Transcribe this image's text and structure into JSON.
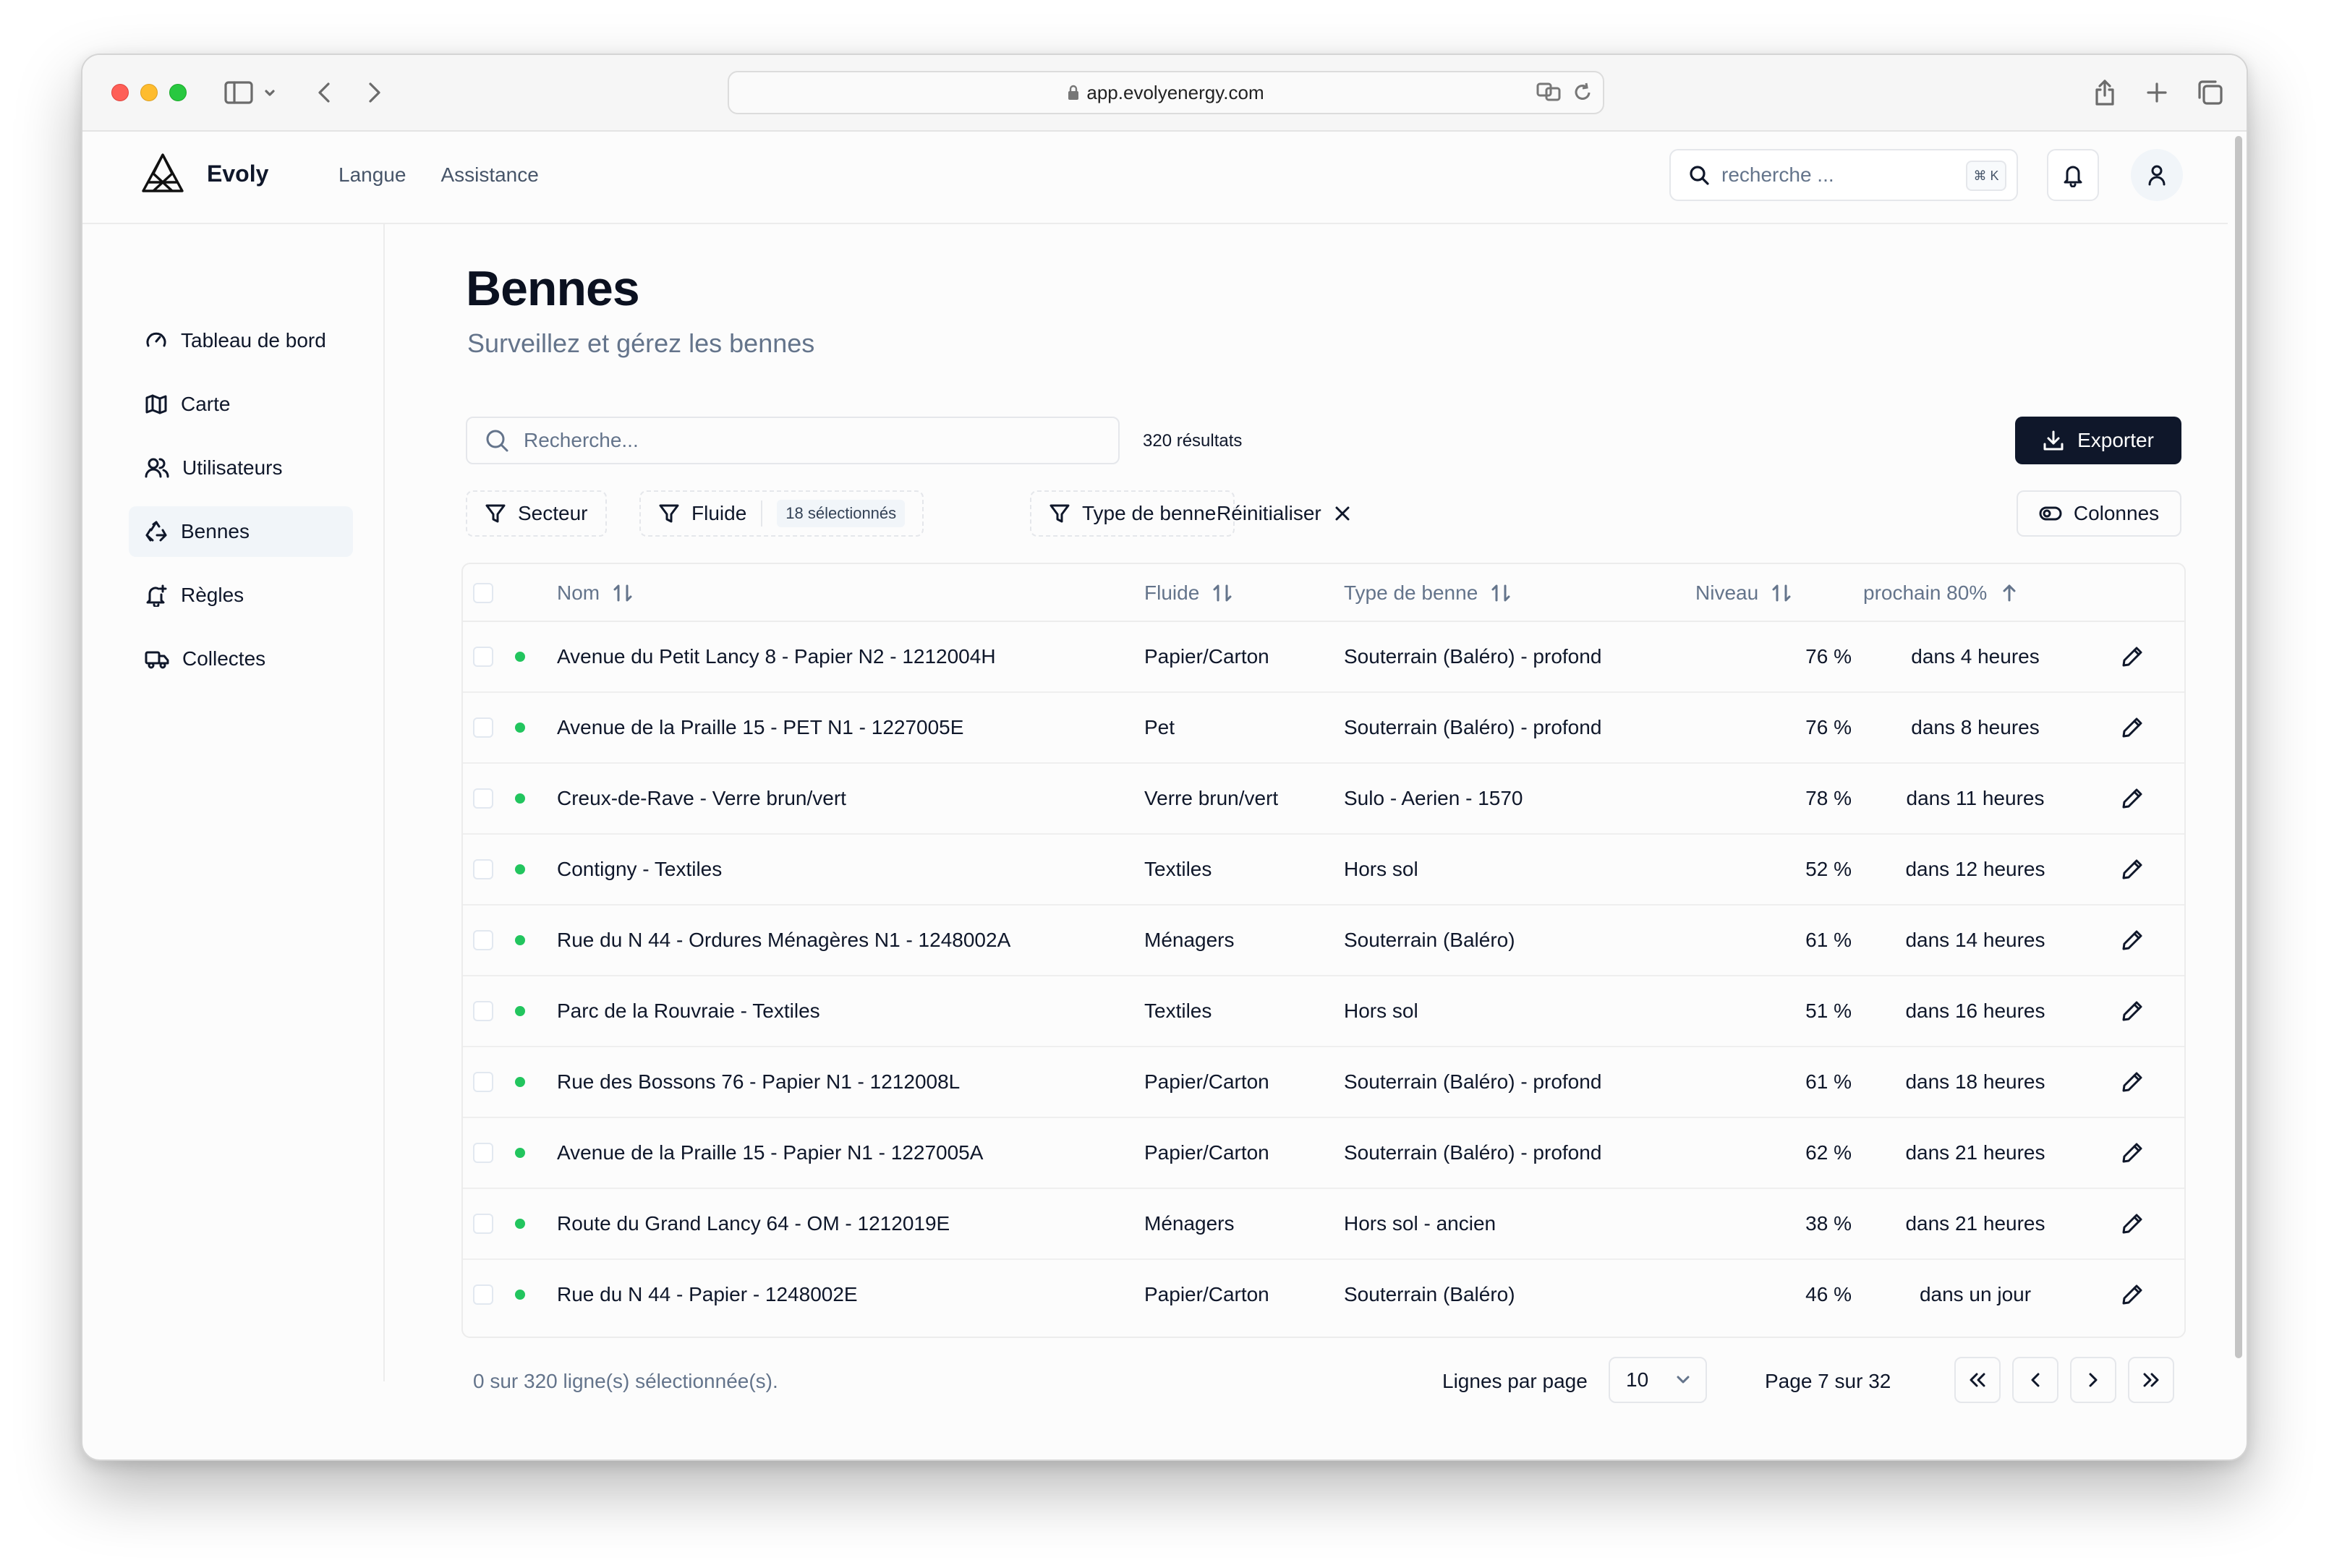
{
  "browser": {
    "url": "app.evolyenergy.com"
  },
  "header": {
    "brand": "Evoly",
    "nav": [
      "Langue",
      "Assistance"
    ],
    "search_placeholder": "recherche ...",
    "search_shortcut": "⌘ K"
  },
  "sidebar": {
    "items": [
      {
        "label": "Tableau de bord",
        "icon": "gauge-icon"
      },
      {
        "label": "Carte",
        "icon": "map-icon"
      },
      {
        "label": "Utilisateurs",
        "icon": "users-icon"
      },
      {
        "label": "Bennes",
        "icon": "recycle-icon",
        "active": true
      },
      {
        "label": "Règles",
        "icon": "bell-plus-icon"
      },
      {
        "label": "Collectes",
        "icon": "truck-icon"
      }
    ]
  },
  "page": {
    "title": "Bennes",
    "subtitle": "Surveillez et gérez les bennes"
  },
  "toolbar": {
    "search_placeholder": "Recherche...",
    "result_count": "320 résultats",
    "export_label": "Exporter",
    "filters": {
      "secteur": "Secteur",
      "fluide": "Fluide",
      "fluide_badge": "18 sélectionnés",
      "type": "Type de benne"
    },
    "reset_label": "Réinitialiser",
    "columns_label": "Colonnes"
  },
  "table": {
    "headers": {
      "nom": "Nom",
      "fluide": "Fluide",
      "type": "Type de benne",
      "niveau": "Niveau",
      "prochain": "prochain 80%"
    },
    "rows": [
      {
        "nom": "Avenue du Petit Lancy 8 - Papier N2 - 1212004H",
        "fluide": "Papier/Carton",
        "type": "Souterrain (Baléro) - profond",
        "niveau": "76 %",
        "prochain": "dans 4 heures"
      },
      {
        "nom": "Avenue de la Praille 15 - PET N1 - 1227005E",
        "fluide": "Pet",
        "type": "Souterrain (Baléro) - profond",
        "niveau": "76 %",
        "prochain": "dans 8 heures"
      },
      {
        "nom": "Creux-de-Rave - Verre brun/vert",
        "fluide": "Verre brun/vert",
        "type": "Sulo - Aerien - 1570",
        "niveau": "78 %",
        "prochain": "dans 11 heures"
      },
      {
        "nom": "Contigny - Textiles",
        "fluide": "Textiles",
        "type": "Hors sol",
        "niveau": "52 %",
        "prochain": "dans 12 heures"
      },
      {
        "nom": "Rue du N 44 - Ordures Ménagères N1 - 1248002A",
        "fluide": "Ménagers",
        "type": "Souterrain (Baléro)",
        "niveau": "61 %",
        "prochain": "dans 14 heures"
      },
      {
        "nom": "Parc de la Rouvraie - Textiles",
        "fluide": "Textiles",
        "type": "Hors sol",
        "niveau": "51 %",
        "prochain": "dans 16 heures"
      },
      {
        "nom": "Rue des Bossons 76 - Papier N1 - 1212008L",
        "fluide": "Papier/Carton",
        "type": "Souterrain (Baléro) - profond",
        "niveau": "61 %",
        "prochain": "dans 18 heures"
      },
      {
        "nom": "Avenue de la Praille 15 - Papier N1 - 1227005A",
        "fluide": "Papier/Carton",
        "type": "Souterrain (Baléro) - profond",
        "niveau": "62 %",
        "prochain": "dans 21 heures"
      },
      {
        "nom": "Route du Grand Lancy 64 - OM - 1212019E",
        "fluide": "Ménagers",
        "type": "Hors sol - ancien",
        "niveau": "38 %",
        "prochain": "dans 21 heures"
      },
      {
        "nom": "Rue du N 44 - Papier - 1248002E",
        "fluide": "Papier/Carton",
        "type": "Souterrain (Baléro)",
        "niveau": "46 %",
        "prochain": "dans un jour"
      }
    ]
  },
  "pagination": {
    "selection_info": "0 sur 320 ligne(s) sélectionnée(s).",
    "rows_per_page_label": "Lignes par page",
    "rows_per_page_value": "10",
    "page_info": "Page 7 sur 32"
  },
  "colors": {
    "primary": "#0f172a",
    "muted": "#64748b",
    "status_ok": "#22c55e",
    "border": "#e5e7eb"
  }
}
